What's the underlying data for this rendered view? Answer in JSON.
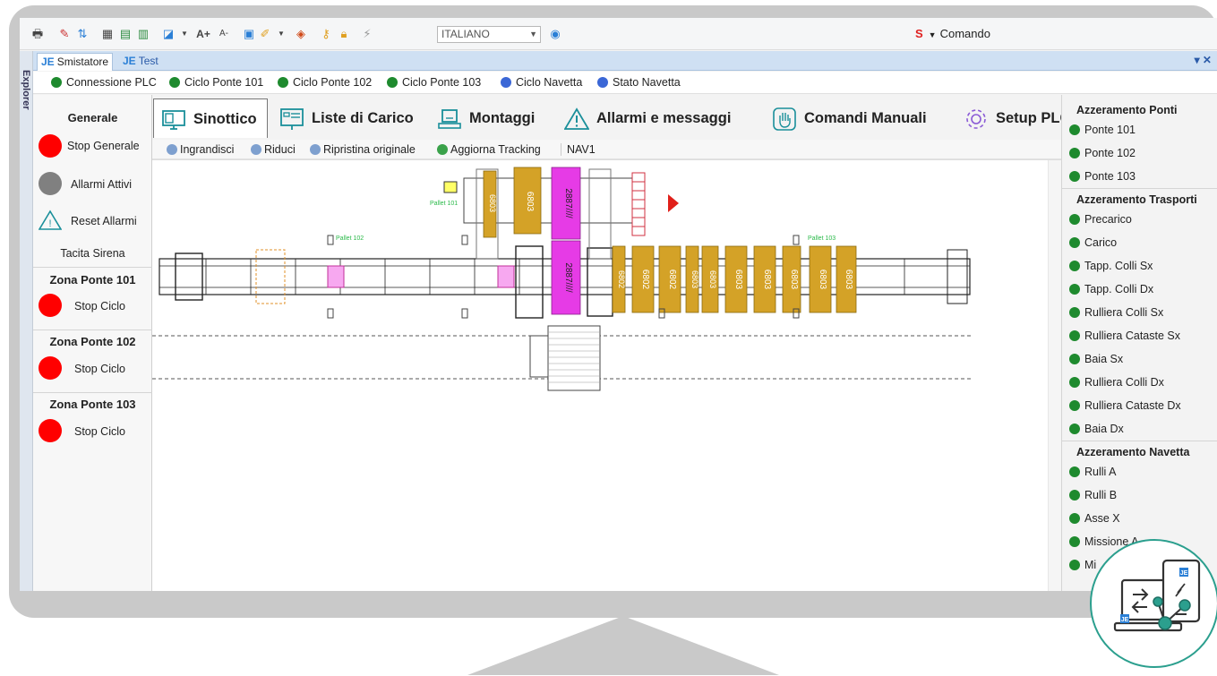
{
  "toolbar": {
    "language": "ITALIANO",
    "comando": "Comando",
    "font_increase": "A+",
    "font_decrease": "A-"
  },
  "sidebar_strip": {
    "label": "Explorer"
  },
  "doc_tabs": [
    {
      "label": "Smistatore",
      "active": true
    },
    {
      "label": "Test",
      "active": false
    }
  ],
  "status_bar": [
    {
      "label": "Connessione PLC",
      "color": "#1e8a2e"
    },
    {
      "label": "Ciclo Ponte 101",
      "color": "#1e8a2e"
    },
    {
      "label": "Ciclo Ponte 102",
      "color": "#1e8a2e"
    },
    {
      "label": "Ciclo Ponte 103",
      "color": "#1e8a2e"
    },
    {
      "label": "Ciclo Navetta",
      "color": "#3b67d6"
    },
    {
      "label": "Stato Navetta",
      "color": "#3b67d6"
    }
  ],
  "left_panel": {
    "generale": "Generale",
    "stop_generale": "Stop Generale",
    "allarmi_attivi": "Allarmi Attivi",
    "reset_allarmi": "Reset Allarmi",
    "tacita_sirena": "Tacita Sirena",
    "zones": [
      {
        "title": "Zona Ponte 101",
        "button": "Stop Ciclo"
      },
      {
        "title": "Zona Ponte 102",
        "button": "Stop Ciclo"
      },
      {
        "title": "Zona Ponte 103",
        "button": "Stop Ciclo"
      }
    ],
    "colors": {
      "stop": "#ff0000",
      "alarm": "#808080"
    }
  },
  "big_tabs": [
    {
      "label": "Sinottico",
      "icon": "monitor-icon",
      "active": true
    },
    {
      "label": "Liste di Carico",
      "icon": "list-board-icon",
      "active": false
    },
    {
      "label": "Montaggi",
      "icon": "laptop-icon",
      "active": false
    },
    {
      "label": "Allarmi e messaggi",
      "icon": "warning-icon",
      "active": false
    },
    {
      "label": "Comandi Manuali",
      "icon": "hand-icon",
      "active": false
    },
    {
      "label": "Setup PLC",
      "icon": "gear-icon",
      "active": false
    }
  ],
  "subbar": {
    "ingrandisci": "Ingrandisci",
    "riduci": "Riduci",
    "ripristina": "Ripristina originale",
    "aggiorna": "Aggiorna Tracking",
    "nav": "NAV1"
  },
  "diagram": {
    "labels": {
      "pallet_101": "Pallet 101",
      "pallet_102": "Pallet 102",
      "pallet_103": "Pallet 103"
    },
    "top_packages": [
      "6803",
      "6803",
      "2887////"
    ],
    "line_magenta": "2887////",
    "line_packages": [
      "6802",
      "6802",
      "6802",
      "6803",
      "6803",
      "6803",
      "6803",
      "6803",
      "6803",
      "6803"
    ],
    "colors": {
      "package": "#d4a227",
      "magenta": "#e63be6",
      "line": "#222222",
      "alarm": "#e0201a"
    }
  },
  "right_panel": {
    "sections": [
      {
        "title": "Azzeramento Ponti",
        "items": [
          "Ponte 101",
          "Ponte 102",
          "Ponte 103"
        ]
      },
      {
        "title": "Azzeramento Trasporti",
        "items": [
          "Precarico",
          "Carico",
          "Tapp. Colli Sx",
          "Tapp. Colli Dx",
          "Rulliera Colli Sx",
          "Rulliera Cataste Sx",
          "Baia Sx",
          "Rulliera Colli Dx",
          "Rulliera Cataste Dx",
          "Baia Dx"
        ]
      },
      {
        "title": "Azzeramento Navetta",
        "items": [
          "Rulli A",
          "Rulli B",
          "Asse X",
          "Missione A",
          "Mi"
        ]
      }
    ],
    "dot_color": "#1e8a2e"
  },
  "logo": {
    "badge_a": "JE",
    "badge_b": "JE"
  }
}
